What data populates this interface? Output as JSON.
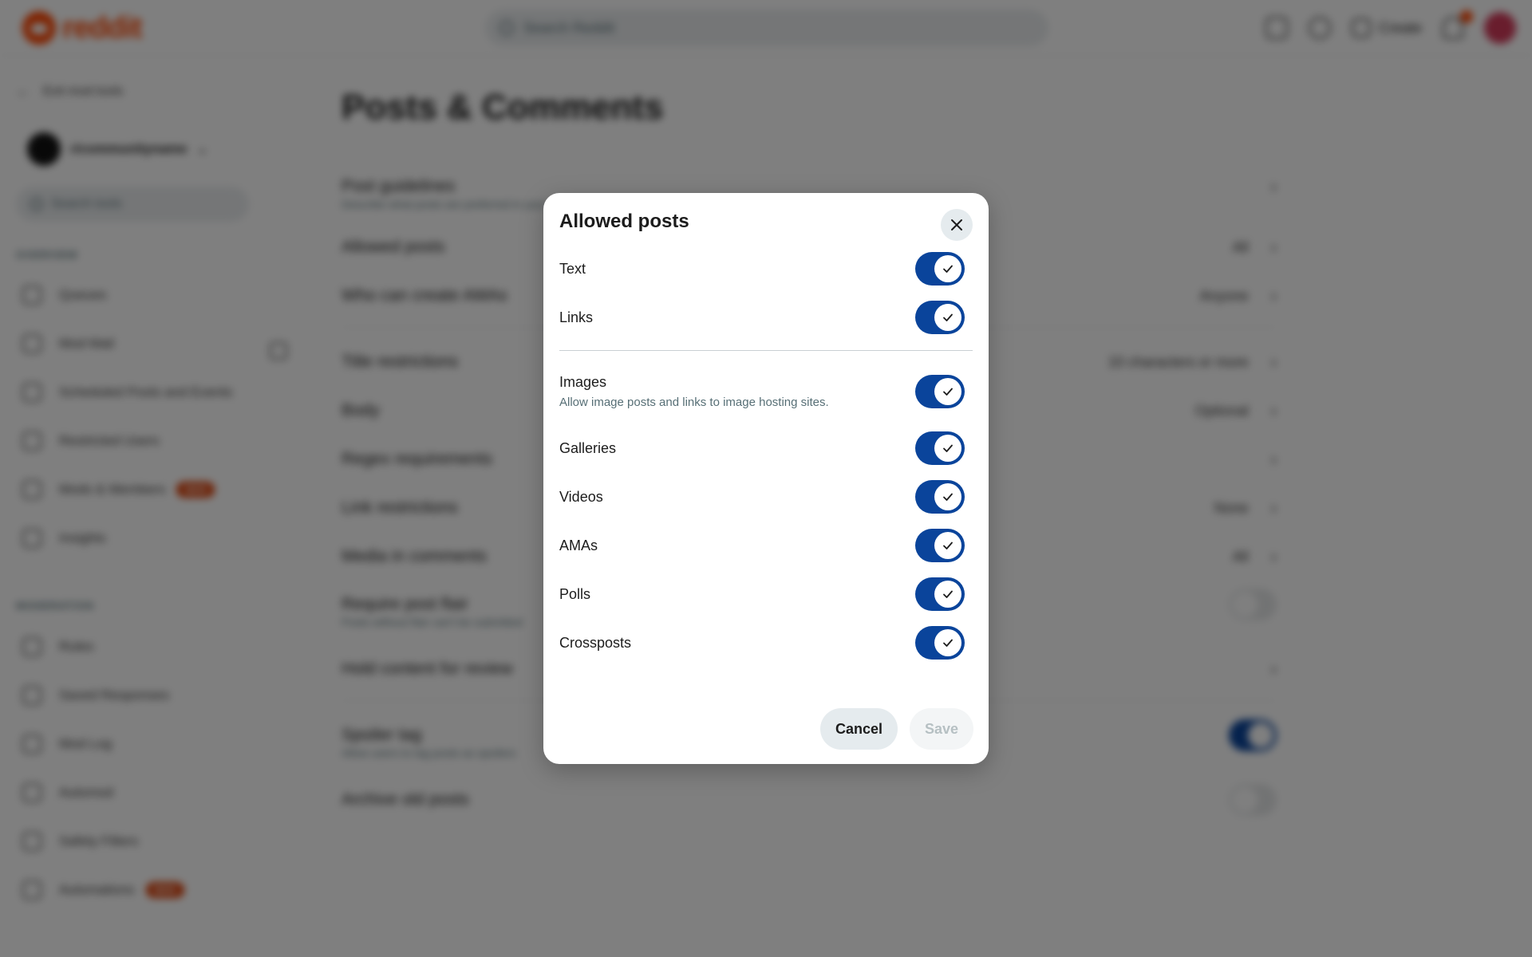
{
  "topbar": {
    "logo_text": "reddit",
    "search_placeholder": "Search Reddit",
    "create_label": "Create"
  },
  "sidebar": {
    "back_label": "Exit mod tools",
    "community": "r/communityname",
    "search_placeholder": "Search tools",
    "overview_heading": "OVERVIEW",
    "overview_items": [
      {
        "label": "Queues",
        "icon": "queue-icon"
      },
      {
        "label": "Mod Mail",
        "icon": "mail-icon"
      },
      {
        "label": "Scheduled Posts and Events",
        "icon": "calendar-icon"
      },
      {
        "label": "Restricted Users",
        "icon": "restricted-icon"
      },
      {
        "label": "Mods & Members",
        "icon": "members-icon",
        "badge": "NEW"
      },
      {
        "label": "Insights",
        "icon": "insights-icon"
      }
    ],
    "moderation_heading": "MODERATION",
    "moderation_items": [
      {
        "label": "Rules",
        "icon": "rules-icon"
      },
      {
        "label": "Saved Responses",
        "icon": "responses-icon"
      },
      {
        "label": "Mod Log",
        "icon": "log-icon"
      },
      {
        "label": "Automod",
        "icon": "automod-icon"
      },
      {
        "label": "Safety Filters",
        "icon": "safety-icon"
      },
      {
        "label": "Automations",
        "icon": "automations-icon",
        "badge": "NEW"
      }
    ]
  },
  "main": {
    "title": "Posts & Comments",
    "rows": [
      {
        "label": "Post guidelines",
        "sub": "Describe what posts are preferred in your community",
        "value": ""
      },
      {
        "label": "Allowed posts",
        "value": "All"
      },
      {
        "label": "Who can create AMAs",
        "value": "Anyone"
      },
      {
        "label": "Title restrictions",
        "value": "10 characters or more"
      },
      {
        "label": "Body",
        "value": "Optional"
      },
      {
        "label": "Regex requirements",
        "value": ""
      },
      {
        "label": "Link restrictions",
        "value": "None"
      },
      {
        "label": "Media in comments",
        "value": "All"
      },
      {
        "label": "Require post flair",
        "sub": "Posts without flair can't be submitted",
        "value": ""
      },
      {
        "label": "Hold content for review",
        "value": ""
      },
      {
        "label": "Spoiler tag",
        "sub": "Allow users to tag posts as spoilers",
        "value": ""
      },
      {
        "label": "Archive old posts",
        "value": ""
      }
    ]
  },
  "modal": {
    "title": "Allowed posts",
    "options": [
      {
        "label": "Text",
        "enabled": true
      },
      {
        "label": "Links",
        "enabled": true
      },
      {
        "label": "Images",
        "description": "Allow image posts and links to image hosting sites.",
        "enabled": true
      },
      {
        "label": "Galleries",
        "enabled": true
      },
      {
        "label": "Videos",
        "enabled": true
      },
      {
        "label": "AMAs",
        "enabled": true
      },
      {
        "label": "Polls",
        "enabled": true
      },
      {
        "label": "Crossposts",
        "enabled": true
      }
    ],
    "cancel_label": "Cancel",
    "save_label": "Save"
  },
  "colors": {
    "accent": "#0a449b",
    "brand": "#ff4500",
    "overlay": "rgba(0,0,0,0.5)"
  }
}
